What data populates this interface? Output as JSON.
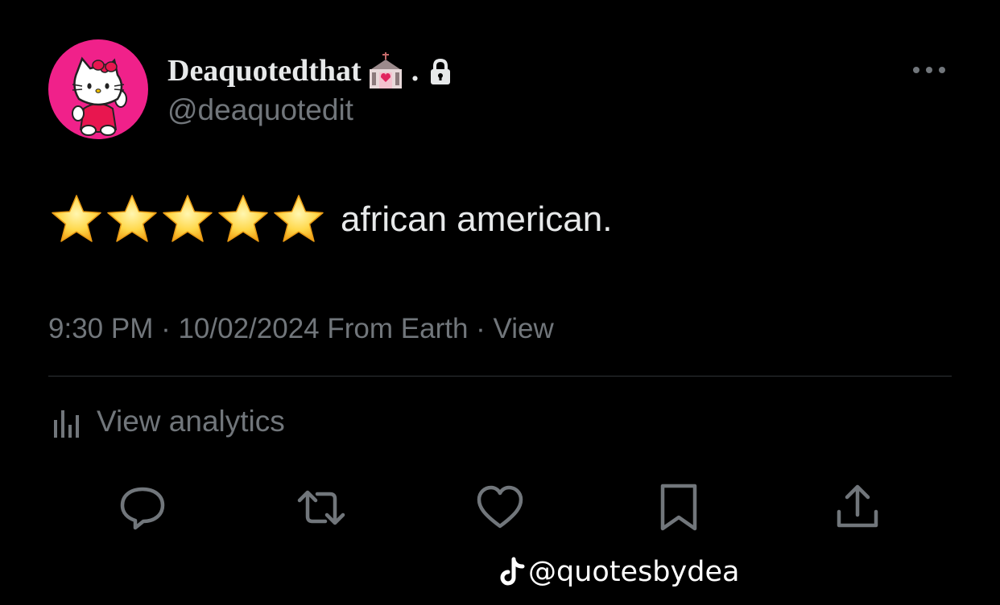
{
  "tweet": {
    "display_name": "Deaquotedthat",
    "name_suffix": ".",
    "handle": "@deaquotedit",
    "body_text": "african american.",
    "rating_stars": 5,
    "time": "9:30 PM",
    "date": "10/02/2024",
    "source": "From Earth",
    "views_label": "View",
    "separator": " · "
  },
  "analytics": {
    "label": "View analytics"
  },
  "actions": [
    {
      "name": "reply",
      "icon": "reply-bubble-icon"
    },
    {
      "name": "retweet",
      "icon": "retweet-icon"
    },
    {
      "name": "like",
      "icon": "heart-icon"
    },
    {
      "name": "bookmark",
      "icon": "bookmark-icon"
    },
    {
      "name": "share",
      "icon": "share-upload-icon"
    }
  ],
  "watermark": {
    "text": "@quotesbydea"
  },
  "colors": {
    "background": "#000000",
    "primary_text": "#e7e9ea",
    "secondary_text": "#71767b",
    "avatar_bg": "#f0218a",
    "divider": "#2f3336"
  }
}
